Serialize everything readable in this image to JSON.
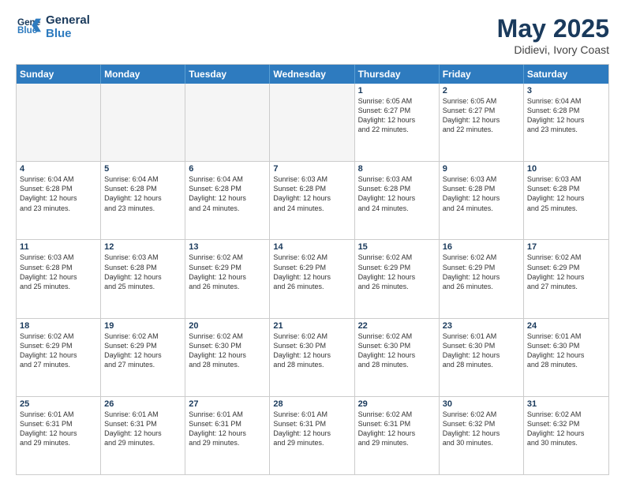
{
  "header": {
    "logo_line1": "General",
    "logo_line2": "Blue",
    "month_year": "May 2025",
    "location": "Didievi, Ivory Coast"
  },
  "days_of_week": [
    "Sunday",
    "Monday",
    "Tuesday",
    "Wednesday",
    "Thursday",
    "Friday",
    "Saturday"
  ],
  "weeks": [
    [
      {
        "day": "",
        "text": "",
        "empty": true
      },
      {
        "day": "",
        "text": "",
        "empty": true
      },
      {
        "day": "",
        "text": "",
        "empty": true
      },
      {
        "day": "",
        "text": "",
        "empty": true
      },
      {
        "day": "1",
        "text": "Sunrise: 6:05 AM\nSunset: 6:27 PM\nDaylight: 12 hours\nand 22 minutes.",
        "empty": false
      },
      {
        "day": "2",
        "text": "Sunrise: 6:05 AM\nSunset: 6:27 PM\nDaylight: 12 hours\nand 22 minutes.",
        "empty": false
      },
      {
        "day": "3",
        "text": "Sunrise: 6:04 AM\nSunset: 6:28 PM\nDaylight: 12 hours\nand 23 minutes.",
        "empty": false
      }
    ],
    [
      {
        "day": "4",
        "text": "Sunrise: 6:04 AM\nSunset: 6:28 PM\nDaylight: 12 hours\nand 23 minutes.",
        "empty": false
      },
      {
        "day": "5",
        "text": "Sunrise: 6:04 AM\nSunset: 6:28 PM\nDaylight: 12 hours\nand 23 minutes.",
        "empty": false
      },
      {
        "day": "6",
        "text": "Sunrise: 6:04 AM\nSunset: 6:28 PM\nDaylight: 12 hours\nand 24 minutes.",
        "empty": false
      },
      {
        "day": "7",
        "text": "Sunrise: 6:03 AM\nSunset: 6:28 PM\nDaylight: 12 hours\nand 24 minutes.",
        "empty": false
      },
      {
        "day": "8",
        "text": "Sunrise: 6:03 AM\nSunset: 6:28 PM\nDaylight: 12 hours\nand 24 minutes.",
        "empty": false
      },
      {
        "day": "9",
        "text": "Sunrise: 6:03 AM\nSunset: 6:28 PM\nDaylight: 12 hours\nand 24 minutes.",
        "empty": false
      },
      {
        "day": "10",
        "text": "Sunrise: 6:03 AM\nSunset: 6:28 PM\nDaylight: 12 hours\nand 25 minutes.",
        "empty": false
      }
    ],
    [
      {
        "day": "11",
        "text": "Sunrise: 6:03 AM\nSunset: 6:28 PM\nDaylight: 12 hours\nand 25 minutes.",
        "empty": false
      },
      {
        "day": "12",
        "text": "Sunrise: 6:03 AM\nSunset: 6:28 PM\nDaylight: 12 hours\nand 25 minutes.",
        "empty": false
      },
      {
        "day": "13",
        "text": "Sunrise: 6:02 AM\nSunset: 6:29 PM\nDaylight: 12 hours\nand 26 minutes.",
        "empty": false
      },
      {
        "day": "14",
        "text": "Sunrise: 6:02 AM\nSunset: 6:29 PM\nDaylight: 12 hours\nand 26 minutes.",
        "empty": false
      },
      {
        "day": "15",
        "text": "Sunrise: 6:02 AM\nSunset: 6:29 PM\nDaylight: 12 hours\nand 26 minutes.",
        "empty": false
      },
      {
        "day": "16",
        "text": "Sunrise: 6:02 AM\nSunset: 6:29 PM\nDaylight: 12 hours\nand 26 minutes.",
        "empty": false
      },
      {
        "day": "17",
        "text": "Sunrise: 6:02 AM\nSunset: 6:29 PM\nDaylight: 12 hours\nand 27 minutes.",
        "empty": false
      }
    ],
    [
      {
        "day": "18",
        "text": "Sunrise: 6:02 AM\nSunset: 6:29 PM\nDaylight: 12 hours\nand 27 minutes.",
        "empty": false
      },
      {
        "day": "19",
        "text": "Sunrise: 6:02 AM\nSunset: 6:29 PM\nDaylight: 12 hours\nand 27 minutes.",
        "empty": false
      },
      {
        "day": "20",
        "text": "Sunrise: 6:02 AM\nSunset: 6:30 PM\nDaylight: 12 hours\nand 28 minutes.",
        "empty": false
      },
      {
        "day": "21",
        "text": "Sunrise: 6:02 AM\nSunset: 6:30 PM\nDaylight: 12 hours\nand 28 minutes.",
        "empty": false
      },
      {
        "day": "22",
        "text": "Sunrise: 6:02 AM\nSunset: 6:30 PM\nDaylight: 12 hours\nand 28 minutes.",
        "empty": false
      },
      {
        "day": "23",
        "text": "Sunrise: 6:01 AM\nSunset: 6:30 PM\nDaylight: 12 hours\nand 28 minutes.",
        "empty": false
      },
      {
        "day": "24",
        "text": "Sunrise: 6:01 AM\nSunset: 6:30 PM\nDaylight: 12 hours\nand 28 minutes.",
        "empty": false
      }
    ],
    [
      {
        "day": "25",
        "text": "Sunrise: 6:01 AM\nSunset: 6:31 PM\nDaylight: 12 hours\nand 29 minutes.",
        "empty": false
      },
      {
        "day": "26",
        "text": "Sunrise: 6:01 AM\nSunset: 6:31 PM\nDaylight: 12 hours\nand 29 minutes.",
        "empty": false
      },
      {
        "day": "27",
        "text": "Sunrise: 6:01 AM\nSunset: 6:31 PM\nDaylight: 12 hours\nand 29 minutes.",
        "empty": false
      },
      {
        "day": "28",
        "text": "Sunrise: 6:01 AM\nSunset: 6:31 PM\nDaylight: 12 hours\nand 29 minutes.",
        "empty": false
      },
      {
        "day": "29",
        "text": "Sunrise: 6:02 AM\nSunset: 6:31 PM\nDaylight: 12 hours\nand 29 minutes.",
        "empty": false
      },
      {
        "day": "30",
        "text": "Sunrise: 6:02 AM\nSunset: 6:32 PM\nDaylight: 12 hours\nand 30 minutes.",
        "empty": false
      },
      {
        "day": "31",
        "text": "Sunrise: 6:02 AM\nSunset: 6:32 PM\nDaylight: 12 hours\nand 30 minutes.",
        "empty": false
      }
    ]
  ]
}
